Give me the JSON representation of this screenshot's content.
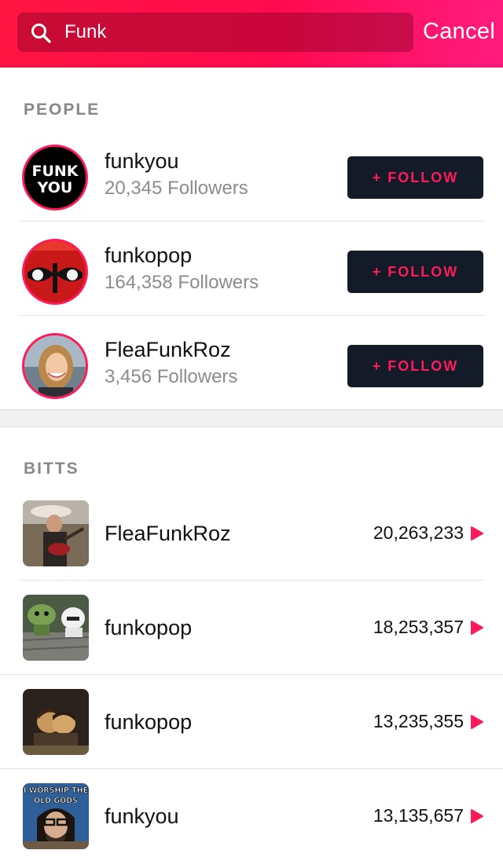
{
  "search": {
    "value": "Funk",
    "cancel_label": "Cancel"
  },
  "colors": {
    "accent": "#ff1a5a",
    "button_bg": "#131a28",
    "muted_text": "#8c8c8c"
  },
  "people": {
    "title": "PEOPLE",
    "items": [
      {
        "name": "funkyou",
        "followers": "20,345 Followers",
        "follow_label": "+ FOLLOW",
        "avatar_text_1": "FUNK",
        "avatar_text_2": "YOU"
      },
      {
        "name": "funkopop",
        "followers": "164,358 Followers",
        "follow_label": "+ FOLLOW"
      },
      {
        "name": "FleaFunkRoz",
        "followers": "3,456 Followers",
        "follow_label": "+ FOLLOW"
      }
    ]
  },
  "bitts": {
    "title": "BITTS",
    "items": [
      {
        "name": "FleaFunkRoz",
        "views": "20,263,233"
      },
      {
        "name": "funkopop",
        "views": "18,253,357"
      },
      {
        "name": "funkopop",
        "views": "13,235,355"
      },
      {
        "name": "funkyou",
        "views": "13,135,657",
        "meme_text_1": "I WORSHIP THE",
        "meme_text_2": "OLD GODS"
      }
    ]
  }
}
